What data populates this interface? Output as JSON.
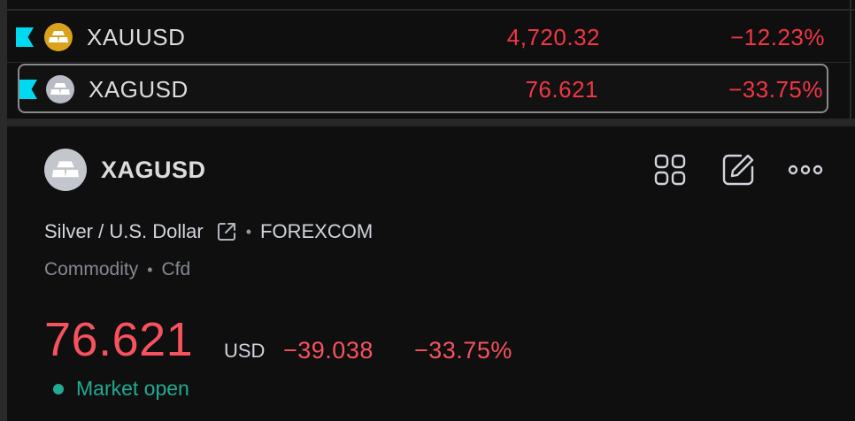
{
  "watchlist": {
    "rows": [
      {
        "symbol": "XAUUSD",
        "price": "4,720.32",
        "change_pct": "−12.23%",
        "icon": "gold-bars-icon",
        "selected": false
      },
      {
        "symbol": "XAGUSD",
        "price": "76.621",
        "change_pct": "−33.75%",
        "icon": "silver-bars-icon",
        "selected": true
      }
    ]
  },
  "detail": {
    "symbol": "XAGUSD",
    "description": "Silver / U.S. Dollar",
    "exchange": "FOREXCOM",
    "type": "Commodity",
    "subtype": "Cfd",
    "price": "76.621",
    "currency": "USD",
    "change_abs": "−39.038",
    "change_pct": "−33.75%",
    "market_status": "Market open",
    "separator": "•",
    "toolbar": {
      "grid_icon": "grid-layout-icon",
      "edit_icon": "edit-note-icon",
      "more_icon": "more-horizontal-icon"
    }
  },
  "colors": {
    "background": "#0f0f0f",
    "negative": "#f23645",
    "positive_status": "#22ab94",
    "flag": "#00d9f2",
    "gold_coin": "#d9a21a",
    "silver_coin": "#b9bcc6"
  }
}
